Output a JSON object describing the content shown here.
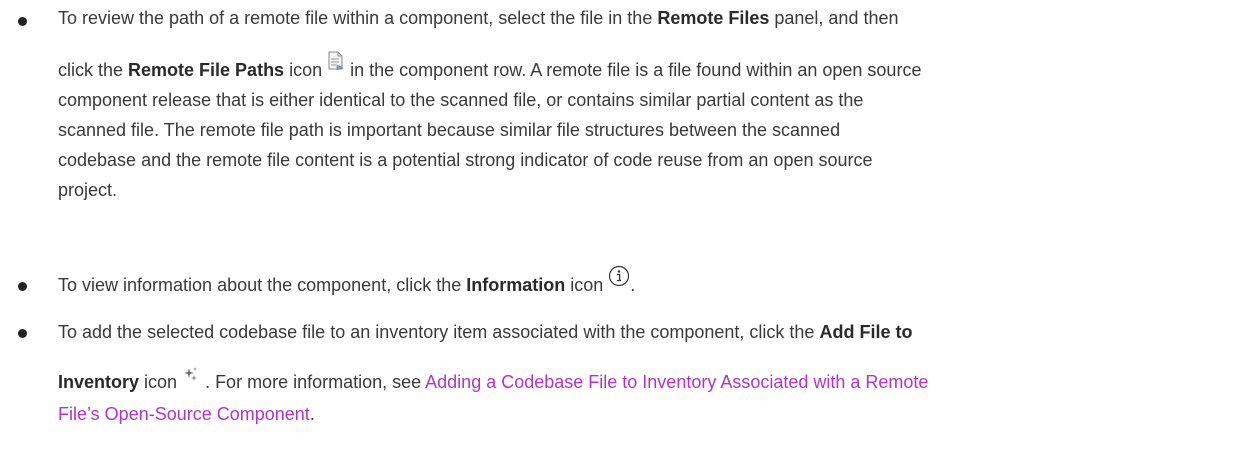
{
  "items": [
    {
      "t1": "To review the path of a remote file within a component, select the file in the ",
      "b1": "Remote Files",
      "t2": " panel, and then",
      "t3": "click the ",
      "b2": "Remote File Paths",
      "t4": " icon ",
      "icon": "document-paths-icon",
      "t5": " in the component row. A remote file is a file found within an open source",
      "l3": "component release that is either identical to the scanned file, or contains similar partial content as the",
      "l4": "scanned file. The remote file path is important because similar file structures between the scanned",
      "l5": "codebase and the remote file content is a potential strong indicator of code reuse from an open source",
      "l6": "project."
    },
    {
      "t1": "To view information about the component, click the ",
      "b1": "Information",
      "t2": " icon ",
      "icon": "info-circle-icon",
      "t3": "."
    },
    {
      "t1": "To add the selected codebase file to an inventory item associated with the component, click the ",
      "b1": "Add File to",
      "b2": "Inventory",
      "t2": " icon ",
      "icon": "add-to-inventory-icon",
      "t3": " . For more information, see ",
      "link1": "Adding a Codebase File to Inventory Associated with a Remote",
      "link2": "File’s Open-Source Component",
      "t4": "."
    }
  ],
  "colors": {
    "text": "#3a3a3a",
    "link": "#b233c8",
    "bullet": "#222222"
  }
}
